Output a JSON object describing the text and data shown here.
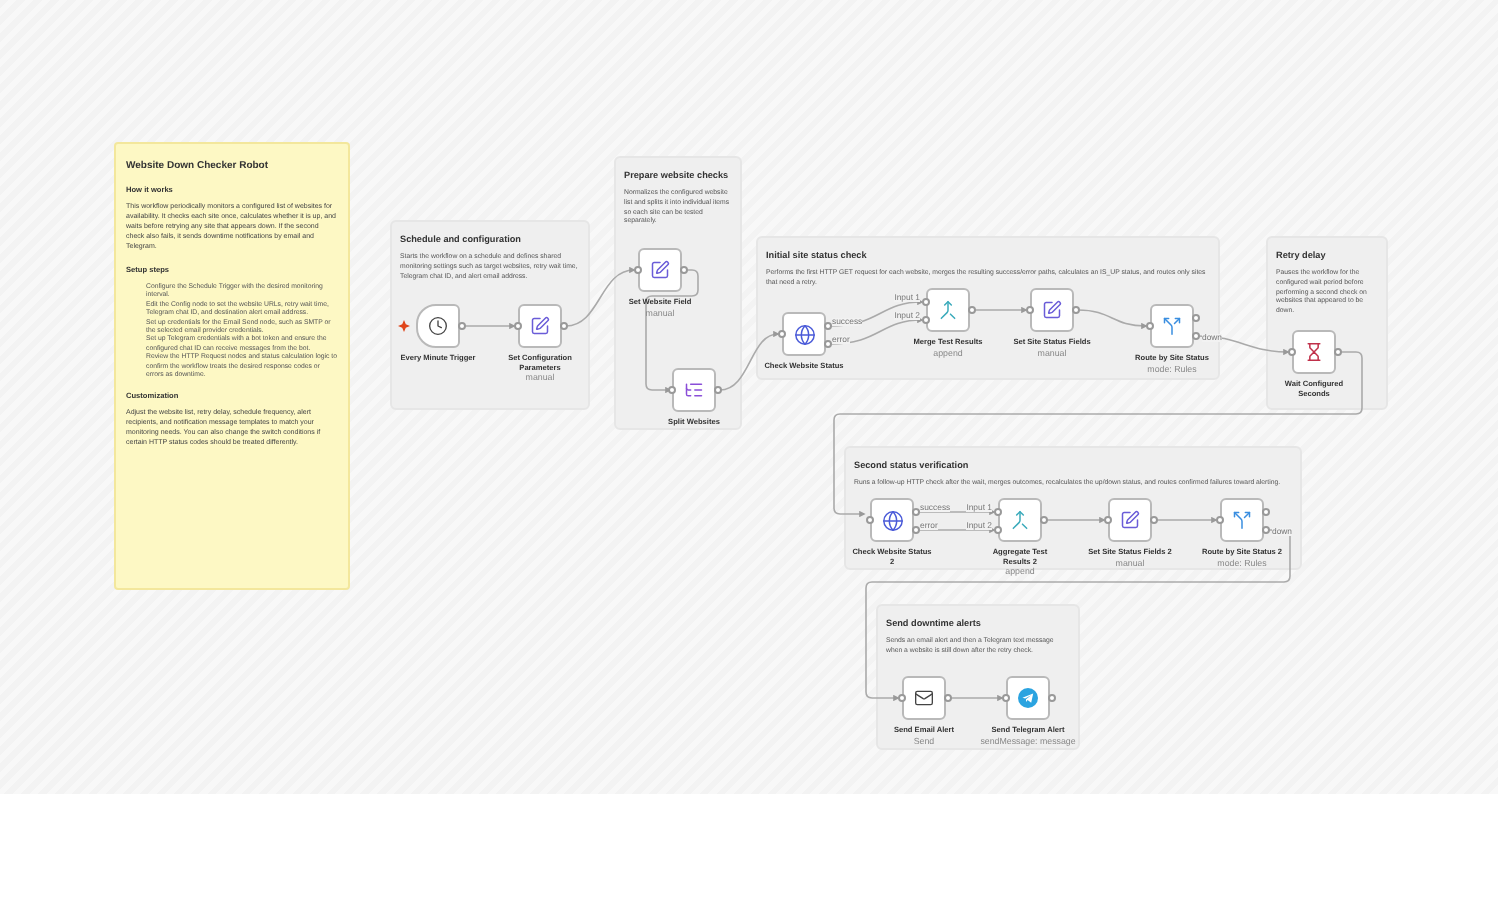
{
  "sticky": {
    "title": "Website Down Checker Robot",
    "sections": [
      {
        "heading": "How it works",
        "paragraph": "This workflow periodically monitors a configured list of websites for availability. It checks each site once, calculates whether it is up, and waits before retrying any site that appears down. If the second check also fails, it sends downtime notifications by email and Telegram."
      },
      {
        "heading": "Setup steps",
        "bullets": [
          "Configure the Schedule Trigger with the desired monitoring interval.",
          "Edit the Config node to set the website URLs, retry wait time, Telegram chat ID, and destination alert email address.",
          "Set up credentials for the Email Send node, such as SMTP or the selected email provider credentials.",
          "Set up Telegram credentials with a bot token and ensure the configured chat ID can receive messages from the bot.",
          "Review the HTTP Request nodes and status calculation logic to confirm the workflow treats the desired response codes or errors as downtime."
        ]
      },
      {
        "heading": "Customization",
        "paragraph": "Adjust the website list, retry delay, schedule frequency, alert recipients, and notification message templates to match your monitoring needs. You can also change the switch conditions if certain HTTP status codes should be treated differently."
      }
    ]
  },
  "notes": [
    {
      "title": "Schedule and configuration",
      "body": "Starts the workflow on a schedule and defines shared monitoring settings such as target websites, retry wait time, Telegram chat ID, and alert email address."
    },
    {
      "title": "Prepare website checks",
      "body": "Normalizes the configured website list and splits it into individual items so each site can be tested separately."
    },
    {
      "title": "Initial site status check",
      "body": "Performs the first HTTP GET request for each website, merges the resulting success/error paths, calculates an IS_UP status, and routes only sites that need a retry."
    },
    {
      "title": "Retry delay",
      "body": "Pauses the workflow for the configured wait period before performing a second check on websites that appeared to be down."
    },
    {
      "title": "Second status verification",
      "body": "Runs a follow-up HTTP check after the wait, merges outcomes, recalculates the up/down status, and routes confirmed failures toward alerting."
    },
    {
      "title": "Send downtime alerts",
      "body": "Sends an email alert and then a Telegram text message when a website is still down after the retry check."
    }
  ],
  "nodes": [
    {
      "kind": "trigger",
      "label": "Every Minute Trigger"
    },
    {
      "kind": "set",
      "label": "Set Configuration Parameters",
      "subtitle": "manual"
    },
    {
      "kind": "set",
      "label": "Set Website Field",
      "subtitle": "manual"
    },
    {
      "kind": "split",
      "label": "Split Websites"
    },
    {
      "kind": "http",
      "label": "Check Website Status",
      "outputs": [
        "success",
        "error"
      ]
    },
    {
      "kind": "merge",
      "label": "Merge Test Results",
      "subtitle": "append",
      "inputs": [
        "Input 1",
        "Input 2"
      ]
    },
    {
      "kind": "set",
      "label": "Set Site Status Fields",
      "subtitle": "manual"
    },
    {
      "kind": "switch",
      "label": "Route by Site Status",
      "subtitle": "mode: Rules",
      "output_label": "down"
    },
    {
      "kind": "wait",
      "label": "Wait Configured Seconds"
    },
    {
      "kind": "http",
      "label": "Check Website Status 2",
      "outputs": [
        "success",
        "error"
      ]
    },
    {
      "kind": "merge",
      "label": "Aggregate Test Results 2",
      "subtitle": "append",
      "inputs": [
        "Input 1",
        "Input 2"
      ]
    },
    {
      "kind": "set",
      "label": "Set Site Status Fields 2",
      "subtitle": "manual"
    },
    {
      "kind": "switch",
      "label": "Route by Site Status 2",
      "subtitle": "mode: Rules",
      "output_label": "down"
    },
    {
      "kind": "email",
      "label": "Send Email Alert",
      "subtitle": "Send"
    },
    {
      "kind": "telegram",
      "label": "Send Telegram Alert",
      "subtitle": "sendMessage: message"
    }
  ]
}
